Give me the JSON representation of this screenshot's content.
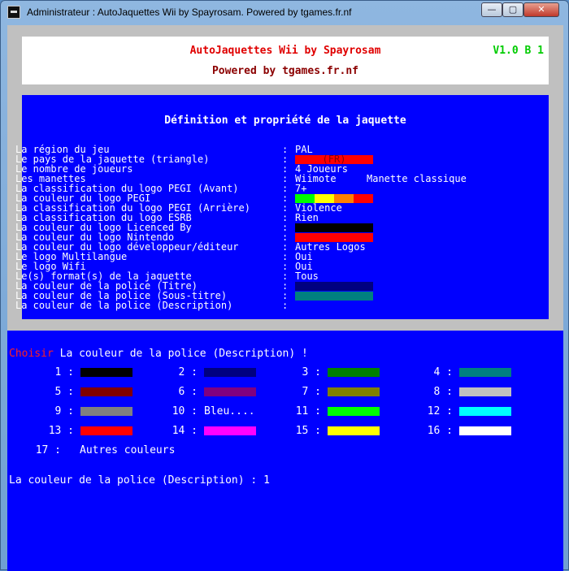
{
  "window": {
    "title": "Administrateur :  AutoJaquettes Wii by Spayrosam. Powered by tgames.fr.nf",
    "minimize": "—",
    "maximize": "▢",
    "close": "✕"
  },
  "header": {
    "title": "AutoJaquettes Wii by Spayrosam",
    "version": "V1.0 B 1",
    "powered": "Powered by tgames.fr.nf"
  },
  "panel": {
    "title": "Définition et propriété de la jaquette",
    "rows": [
      {
        "label": "La région du jeu",
        "value": "PAL"
      },
      {
        "label": "Le pays de la jaquette (triangle)",
        "value": "(FR)",
        "bar": [
          "#ff0000"
        ]
      },
      {
        "label": "Le nombre de joueurs",
        "value": "4 Joueurs"
      },
      {
        "label": "Les manettes",
        "value": "Wiimote",
        "value2": "Manette classique"
      },
      {
        "label": "La classification du logo PEGI (Avant)",
        "value": "7+"
      },
      {
        "label": "La couleur du logo PEGI",
        "value": "",
        "bar": [
          "#00ff00",
          "#ffff00",
          "#ff8000",
          "#ff0000"
        ]
      },
      {
        "label": "La classification du logo PEGI (Arrière)",
        "value": "Violence"
      },
      {
        "label": "La classification du logo ESRB",
        "value": "Rien"
      },
      {
        "label": "La couleur du logo Licenced By",
        "value": "",
        "bar": [
          "#000000"
        ]
      },
      {
        "label": "La couleur du logo Nintendo",
        "value": "",
        "bar": [
          "#ff0000"
        ]
      },
      {
        "label": "La couleur du logo développeur/éditeur",
        "value": "Autres Logos"
      },
      {
        "label": "Le logo Multilangue",
        "value": "Oui"
      },
      {
        "label": "Le logo Wifi",
        "value": "Oui"
      },
      {
        "label": "Le(s) format(s) de la jaquette",
        "value": "Tous"
      },
      {
        "label": "La couleur de la police (Titre)",
        "value": "",
        "bar": [
          "#000080"
        ]
      },
      {
        "label": "La couleur de la police (Sous-titre)",
        "value": "",
        "bar": [
          "#008080"
        ]
      },
      {
        "label": "La couleur de la police (Description)",
        "value": ""
      }
    ]
  },
  "prompt": {
    "choose": "Choisir",
    "text": " La couleur de la police (Description) !"
  },
  "colors": [
    {
      "num": "1 :",
      "swatch": "#000000"
    },
    {
      "num": "2 :",
      "swatch": "#000080"
    },
    {
      "num": "3 :",
      "swatch": "#008000"
    },
    {
      "num": "4 :",
      "swatch": "#008080"
    },
    {
      "num": "5 :",
      "swatch": "#800000"
    },
    {
      "num": "6 :",
      "swatch": "#800080"
    },
    {
      "num": "7 :",
      "swatch": "#808000"
    },
    {
      "num": "8 :",
      "swatch": "#c0c0c0"
    },
    {
      "num": "9 :",
      "swatch": "#808080"
    },
    {
      "num": "10 :",
      "text": "Bleu...."
    },
    {
      "num": "11 :",
      "swatch": "#00ff00"
    },
    {
      "num": "12 :",
      "swatch": "#00ffff"
    },
    {
      "num": "13 :",
      "swatch": "#ff0000"
    },
    {
      "num": "14 :",
      "swatch": "#ff00ff"
    },
    {
      "num": "15 :",
      "swatch": "#ffff00"
    },
    {
      "num": "16 :",
      "swatch": "#ffffff"
    }
  ],
  "other_colors": {
    "num": "17 :",
    "label": "Autres couleurs"
  },
  "input_line": "La couleur de la police (Description) : 1"
}
